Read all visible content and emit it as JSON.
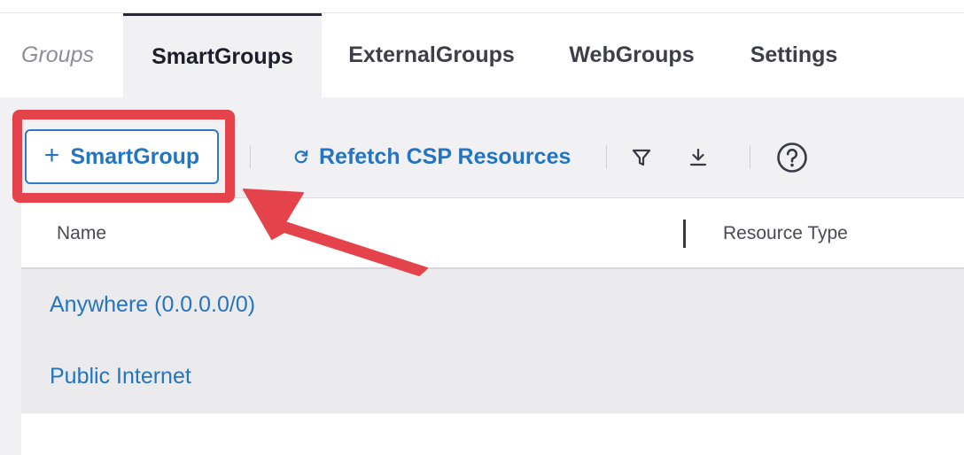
{
  "tabs": [
    {
      "label": "Groups"
    },
    {
      "label": "SmartGroups"
    },
    {
      "label": "ExternalGroups"
    },
    {
      "label": "WebGroups"
    },
    {
      "label": "Settings"
    }
  ],
  "toolbar": {
    "add_plus": "+",
    "add_label": "SmartGroup",
    "refetch_label": "Refetch CSP Resources",
    "filter_icon": "filter-icon",
    "download_icon": "download-icon",
    "help_icon": "help-icon"
  },
  "table": {
    "columns": [
      "Name",
      "Resource Type"
    ],
    "rows": [
      {
        "name": "Anywhere (0.0.0.0/0)",
        "resource_type": ""
      },
      {
        "name": "Public Internet",
        "resource_type": ""
      }
    ]
  },
  "colors": {
    "accent": "#2474c0",
    "annotation": "#e5434b",
    "active_tab_bg": "#f1f1f4"
  }
}
